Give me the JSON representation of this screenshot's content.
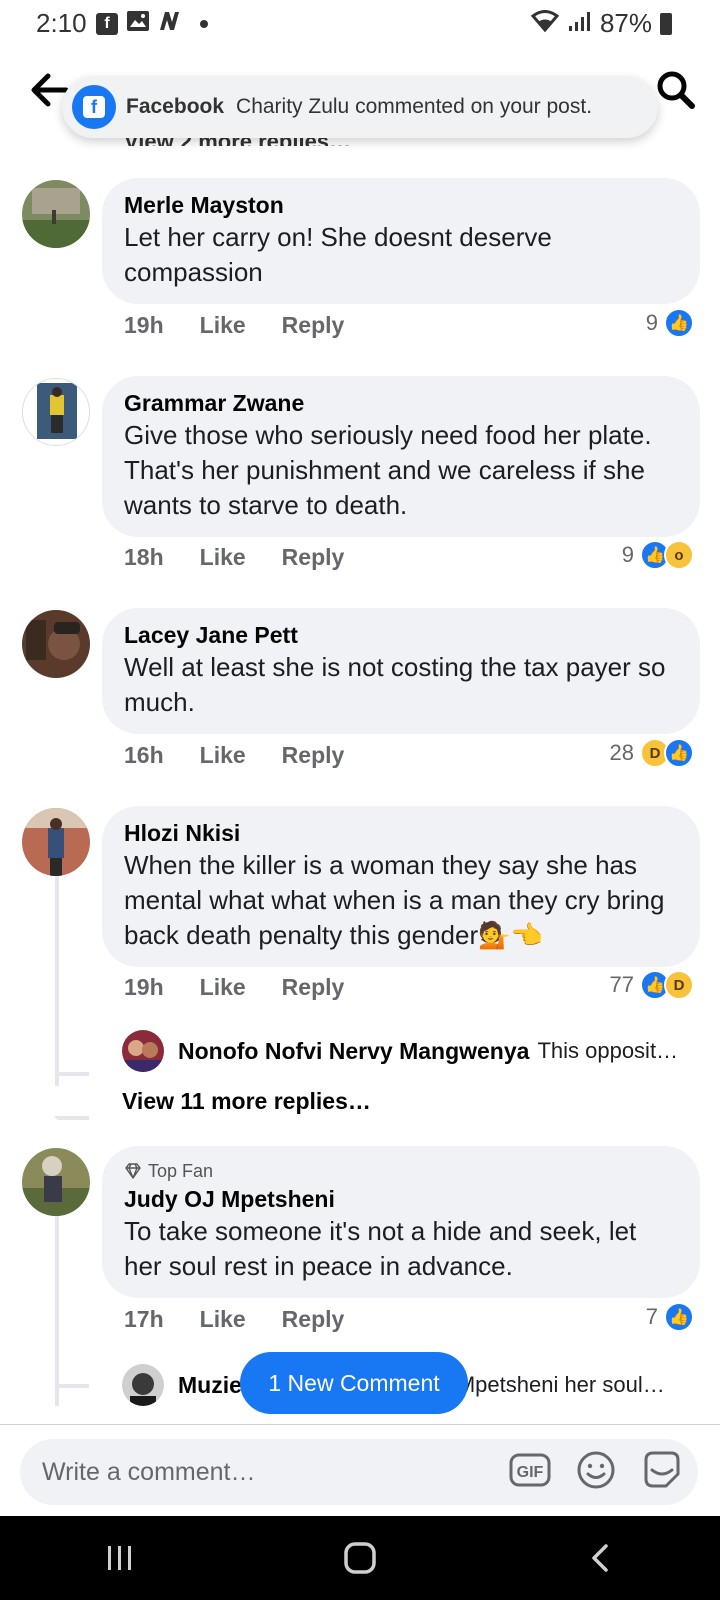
{
  "status_bar": {
    "time": "2:10",
    "battery": "87%",
    "left_icons": [
      "facebook-icon",
      "image-icon",
      "news-icon",
      "dot-icon"
    ],
    "right_icons": [
      "wifi-icon",
      "signal-icon",
      "battery-icon"
    ]
  },
  "notification": {
    "app": "Facebook",
    "text": "Charity Zulu commented on your post."
  },
  "hidden_replies_text": "View 2 more replies…",
  "comments": [
    {
      "name": "Merle Mayston",
      "text": "Let her carry on! She doesnt deserve compassion",
      "time": "19h",
      "like": "Like",
      "reply": "Reply",
      "reaction_count": "9",
      "reactions": [
        "like"
      ]
    },
    {
      "name": "Grammar Zwane",
      "text": "Give those who seriously need food her plate. That's her punishment and we careless if she wants to starve to death.",
      "time": "18h",
      "like": "Like",
      "reply": "Reply",
      "reaction_count": "9",
      "reactions": [
        "like",
        "wow"
      ]
    },
    {
      "name": "Lacey Jane Pett",
      "text": "Well at least she is not costing the tax payer so much.",
      "time": "16h",
      "like": "Like",
      "reply": "Reply",
      "reaction_count": "28",
      "reactions": [
        "haha",
        "like"
      ]
    },
    {
      "name": "Hlozi Nkisi",
      "text": "When the killer is a woman they say she has mental what what when is a man they cry bring back death penalty this gender💁👈",
      "time": "19h",
      "like": "Like",
      "reply": "Reply",
      "reaction_count": "77",
      "reactions": [
        "like",
        "haha"
      ],
      "reply_preview": {
        "name": "Nonofo Nofvi Nervy Mangwenya",
        "text": "This opposit…"
      },
      "view_more": "View 11 more replies…"
    },
    {
      "badge": "Top Fan",
      "name": "Judy OJ Mpetsheni",
      "text": "To take someone it's not a hide and seek, let her soul rest in peace in advance.",
      "time": "17h",
      "like": "Like",
      "reply": "Reply",
      "reaction_count": "7",
      "reactions": [
        "like"
      ],
      "reply_preview": {
        "name": "Muzie Khuzwayo",
        "text": "Judy OJ Mpetsheni her soul…"
      }
    }
  ],
  "new_comment_button": "1 New Comment",
  "composer": {
    "placeholder": "Write a comment…",
    "icons": [
      "gif-icon",
      "emoji-icon",
      "sticker-icon"
    ],
    "gif_label": "GIF"
  },
  "colors": {
    "accent": "#1877f2",
    "bubble": "#f0f2f5",
    "secondary_text": "#65676b"
  }
}
